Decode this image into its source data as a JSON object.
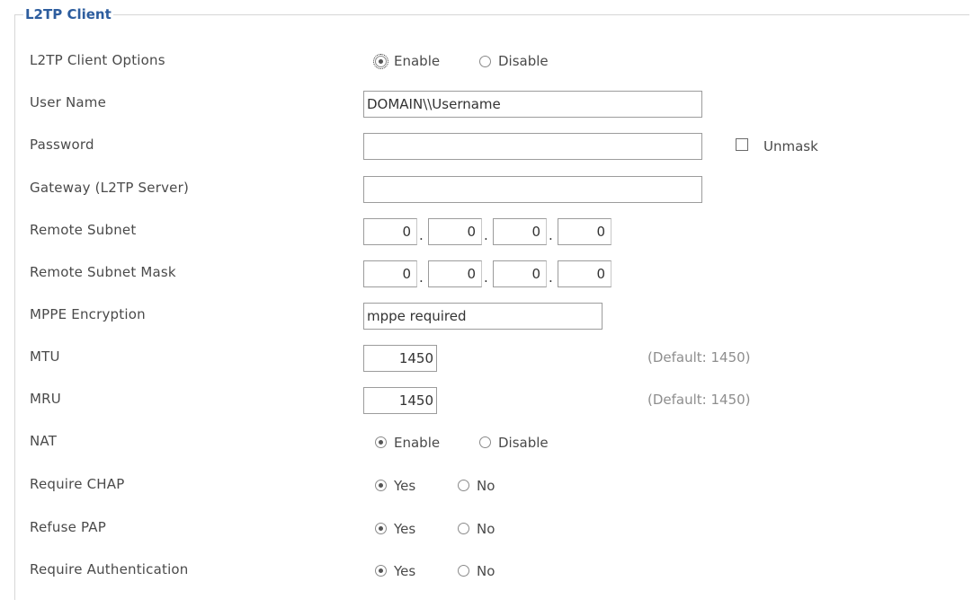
{
  "section_title": "L2TP Client",
  "fields": {
    "client_options": {
      "label": "L2TP Client Options",
      "enable": "Enable",
      "disable": "Disable",
      "selected": "Enable"
    },
    "user_name": {
      "label": "User Name",
      "value": "DOMAIN\\\\Username"
    },
    "password": {
      "label": "Password",
      "value": "",
      "unmask_label": "Unmask"
    },
    "gateway": {
      "label": "Gateway (L2TP Server)",
      "value": ""
    },
    "remote_subnet": {
      "label": "Remote Subnet",
      "octets": [
        "0",
        "0",
        "0",
        "0"
      ]
    },
    "remote_subnet_mask": {
      "label": "Remote Subnet Mask",
      "octets": [
        "0",
        "0",
        "0",
        "0"
      ]
    },
    "mppe": {
      "label": "MPPE Encryption",
      "value": "mppe required"
    },
    "mtu": {
      "label": "MTU",
      "value": "1450",
      "hint": "(Default: 1450)"
    },
    "mru": {
      "label": "MRU",
      "value": "1450",
      "hint": "(Default: 1450)"
    },
    "nat": {
      "label": "NAT",
      "enable": "Enable",
      "disable": "Disable",
      "selected": "Enable"
    },
    "require_chap": {
      "label": "Require CHAP",
      "yes": "Yes",
      "no": "No",
      "selected": "Yes"
    },
    "refuse_pap": {
      "label": "Refuse PAP",
      "yes": "Yes",
      "no": "No",
      "selected": "Yes"
    },
    "require_auth": {
      "label": "Require Authentication",
      "yes": "Yes",
      "no": "No",
      "selected": "Yes"
    }
  },
  "colors": {
    "title": "#2d5d9e",
    "label": "#4a4a4a",
    "hint": "#8e8e8e",
    "border": "#9c9c9c"
  }
}
